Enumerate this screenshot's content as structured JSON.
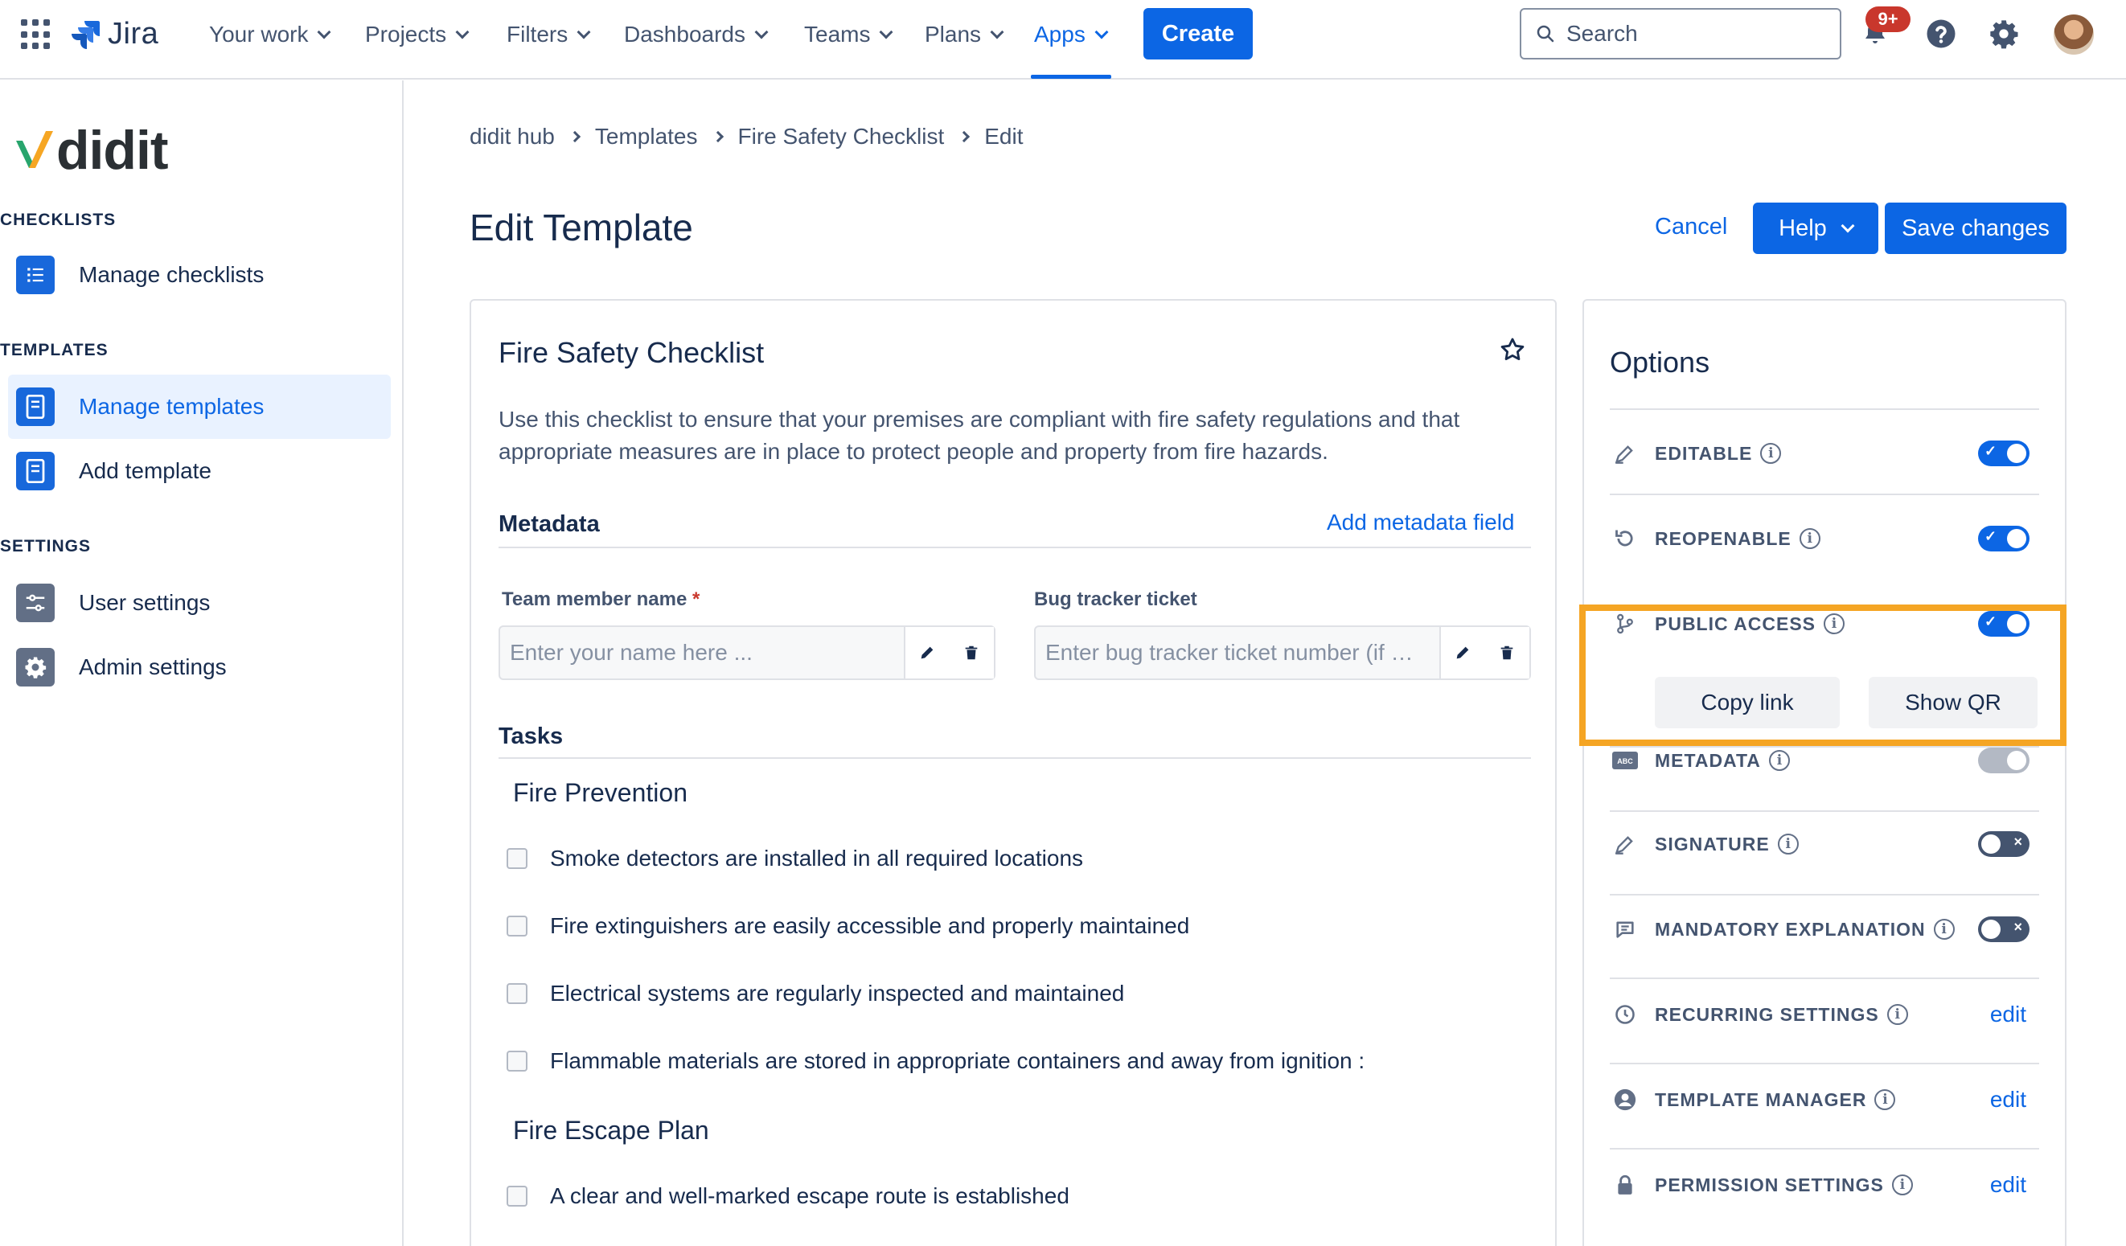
{
  "topnav": {
    "product": "Jira",
    "items": [
      {
        "label": "Your work"
      },
      {
        "label": "Projects"
      },
      {
        "label": "Filters"
      },
      {
        "label": "Dashboards"
      },
      {
        "label": "Teams"
      },
      {
        "label": "Plans"
      },
      {
        "label": "Apps",
        "active": true
      }
    ],
    "create_label": "Create",
    "search_placeholder": "Search",
    "notifications_badge": "9+",
    "accent_color": "#0c66e4"
  },
  "sidebar": {
    "logo_text": "didit",
    "sections": [
      {
        "heading": "CHECKLISTS",
        "items": [
          {
            "label": "Manage checklists",
            "icon": "checklist-icon"
          }
        ]
      },
      {
        "heading": "TEMPLATES",
        "items": [
          {
            "label": "Manage templates",
            "icon": "template-icon",
            "selected": true
          },
          {
            "label": "Add template",
            "icon": "template-icon"
          }
        ]
      },
      {
        "heading": "SETTINGS",
        "items": [
          {
            "label": "User settings",
            "icon": "sliders-icon"
          },
          {
            "label": "Admin settings",
            "icon": "gear-icon"
          }
        ]
      }
    ]
  },
  "breadcrumb": [
    "didit hub",
    "Templates",
    "Fire Safety Checklist",
    "Edit"
  ],
  "page": {
    "title": "Edit Template",
    "cancel_label": "Cancel",
    "help_label": "Help",
    "save_label": "Save changes"
  },
  "template": {
    "name": "Fire Safety Checklist",
    "description": "Use this checklist to ensure that your premises are compliant with fire safety regulations and that appropriate measures are in place to protect people and property from fire hazards.",
    "metadata_heading": "Metadata",
    "add_metadata_label": "Add metadata field",
    "fields": [
      {
        "label": "Team member name",
        "required": "*",
        "placeholder": "Enter your name here ..."
      },
      {
        "label": "Bug tracker ticket",
        "required": "",
        "placeholder": "Enter bug tracker ticket number (if …"
      }
    ],
    "tasks_heading": "Tasks",
    "groups": [
      {
        "title": "Fire Prevention",
        "tasks": [
          "Smoke detectors are installed in all required locations",
          "Fire extinguishers are easily accessible and properly maintained",
          "Electrical systems are regularly inspected and maintained",
          "Flammable materials are stored in appropriate containers and away from ignition :"
        ]
      },
      {
        "title": "Fire Escape Plan",
        "tasks": [
          "A clear and well-marked escape route is established"
        ]
      }
    ]
  },
  "options": {
    "title": "Options",
    "rows": [
      {
        "label": "EDITABLE",
        "type": "toggle",
        "state": "on",
        "icon": "pen-icon"
      },
      {
        "label": "REOPENABLE",
        "type": "toggle",
        "state": "on",
        "icon": "reopen-icon"
      },
      {
        "label": "PUBLIC ACCESS",
        "type": "toggle",
        "state": "on",
        "icon": "branch-icon"
      },
      {
        "label": "METADATA",
        "type": "toggle",
        "state": "disabled",
        "icon": "abc-icon"
      },
      {
        "label": "SIGNATURE",
        "type": "toggle",
        "state": "off",
        "icon": "pen-icon"
      },
      {
        "label": "MANDATORY EXPLANATION",
        "type": "toggle",
        "state": "off",
        "icon": "comment-icon"
      },
      {
        "label": "RECURRING SETTINGS",
        "type": "link",
        "link_label": "edit",
        "icon": "clock-icon"
      },
      {
        "label": "TEMPLATE MANAGER",
        "type": "link",
        "link_label": "edit",
        "icon": "person-icon"
      },
      {
        "label": "PERMISSION SETTINGS",
        "type": "link",
        "link_label": "edit",
        "icon": "lock-icon"
      }
    ],
    "copy_link_label": "Copy link",
    "show_qr_label": "Show QR",
    "highlight_color": "#f5a524"
  }
}
